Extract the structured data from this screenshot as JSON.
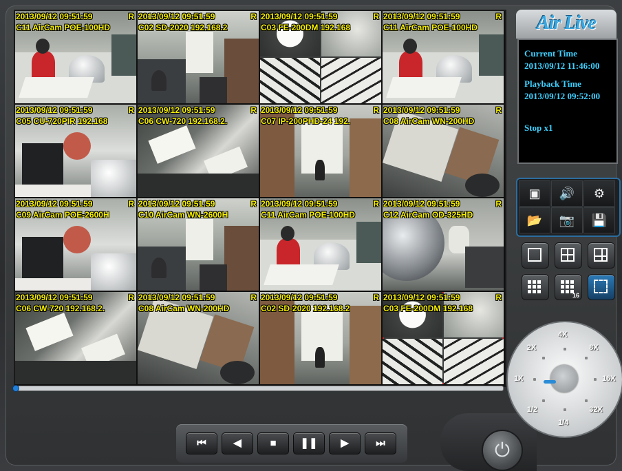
{
  "logo_text": "Air Live",
  "info": {
    "current_time_label": "Current Time",
    "current_time_value": "2013/09/12 11:46:00",
    "playback_time_label": "Playback Time",
    "playback_time_value": "2013/09/12 09:52:00",
    "status": "Stop x1"
  },
  "tiles": [
    {
      "ts": "2013/09/12 09:51:59",
      "rec": "R",
      "name": "C11 AirCam POE-100HD",
      "scene": "desk"
    },
    {
      "ts": "2013/09/12 09:51:59",
      "rec": "R",
      "name": "C02 SD-2020 192.168.2",
      "scene": "office"
    },
    {
      "ts": "2013/09/12 09:51:59",
      "rec": "R",
      "name": "C03 FE-200DM 192.168",
      "scene": "fisheye"
    },
    {
      "ts": "2013/09/12 09:51:59",
      "rec": "R",
      "name": "C11 AirCam POE-100HD",
      "scene": "desk"
    },
    {
      "ts": "2013/09/12 09:51:59",
      "rec": "R",
      "name": "C05 CU-720PIR 192.168",
      "scene": "lab"
    },
    {
      "ts": "2013/09/12 09:51:59",
      "rec": "R",
      "name": "C06 CW-720 192.168.2.",
      "scene": "ceiling"
    },
    {
      "ts": "2013/09/12 09:51:59",
      "rec": "R",
      "name": "C07 IP-200PHD-24 192.",
      "scene": "corridor"
    },
    {
      "ts": "2013/09/12 09:51:59",
      "rec": "R",
      "name": "C08 AirCam WN-200HD",
      "scene": "tilted"
    },
    {
      "ts": "2013/09/12 09:51:59",
      "rec": "R",
      "name": "C09 AirCam POE-2600H",
      "scene": "lab"
    },
    {
      "ts": "2013/09/12 09:51:59",
      "rec": "R",
      "name": "C10 AirCam WN-2600H",
      "scene": "office"
    },
    {
      "ts": "2013/09/12 09:51:59",
      "rec": "R",
      "name": "C11 AirCam POE-100HD",
      "scene": "desk"
    },
    {
      "ts": "2013/09/12 09:51:59",
      "rec": "R",
      "name": "C12 AirCam OD-325HD",
      "scene": "dome"
    },
    {
      "ts": "2013/09/12 09:51:59",
      "rec": "R",
      "name": "C06 CW-720 192.168.2.",
      "scene": "ceiling"
    },
    {
      "ts": "2013/09/12 09:51:59",
      "rec": "R",
      "name": "C08 AirCam WN-200HD",
      "scene": "tilted"
    },
    {
      "ts": "2013/09/12 09:51:59",
      "rec": "R",
      "name": "C02 SD-2020 192.168.2",
      "scene": "corridor"
    },
    {
      "ts": "2013/09/12 09:51:59",
      "rec": "R",
      "name": "C03 FE-200DM 192.168",
      "scene": "fisheye"
    }
  ],
  "selected_tile": 15,
  "playback_position": 0,
  "playback_buttons": [
    {
      "name": "skip-back-button",
      "glyph": "⏮"
    },
    {
      "name": "rewind-button",
      "glyph": "◀"
    },
    {
      "name": "stop-button",
      "glyph": "■"
    },
    {
      "name": "pause-button",
      "glyph": "❚❚"
    },
    {
      "name": "play-button",
      "glyph": "▶"
    },
    {
      "name": "skip-forward-button",
      "glyph": "⏭"
    }
  ],
  "tools": [
    {
      "name": "camera-list-icon",
      "glyph": "▣"
    },
    {
      "name": "volume-icon",
      "glyph": "🔊"
    },
    {
      "name": "settings-icon",
      "glyph": "⚙"
    },
    {
      "name": "folder-icon",
      "glyph": "📂"
    },
    {
      "name": "snapshot-icon",
      "glyph": "📷"
    },
    {
      "name": "save-icon",
      "glyph": "💾"
    }
  ],
  "layouts": [
    {
      "name": "layout-1-button",
      "label": "1"
    },
    {
      "name": "layout-4-button",
      "label": "4"
    },
    {
      "name": "layout-6-button",
      "label": "6"
    },
    {
      "name": "layout-9-button",
      "label": "9"
    },
    {
      "name": "layout-16-button",
      "label": "16"
    },
    {
      "name": "fullscreen-button",
      "label": "full"
    }
  ],
  "speeds": [
    "4X",
    "8X",
    "16X",
    "32X",
    "1/4",
    "1/2",
    "1X",
    "2X"
  ],
  "colors": {
    "accent": "#2a8bd7",
    "osd": "#f6f000",
    "info_text": "#3fd0ff",
    "selected": "#c0282c"
  }
}
